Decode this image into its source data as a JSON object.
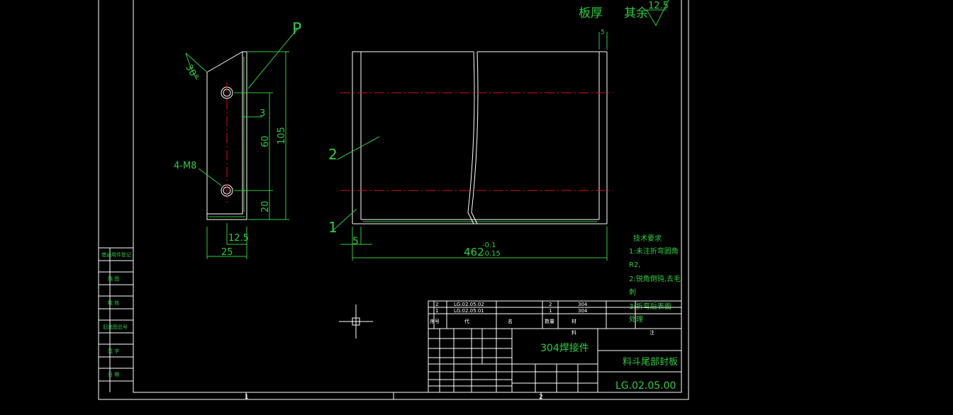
{
  "title_block": {
    "part_name": "料斗尾部封板",
    "drawing_no": "LG.02.05.00",
    "material": "304焊接件",
    "bom": [
      {
        "seq": "2",
        "code": "LG.02.05.02",
        "qty": "2",
        "material": "304"
      },
      {
        "seq": "1",
        "code": "LG.02.05.01",
        "qty": "1",
        "material": "304"
      }
    ],
    "header_seq": "序号",
    "header_code": "代",
    "header_name": "名",
    "header_qty": "数量",
    "header_material": "材",
    "header_misc": "料",
    "header_note": "注"
  },
  "tech_requirements": {
    "title": "技术要求",
    "items": [
      "1:未注折弯圆角",
      "R2,",
      "2:锐角倒钝,去毛",
      "刺",
      "3:折弯后表面",
      "处理"
    ]
  },
  "thickness_note": {
    "label": "板厚",
    "rest": "其余",
    "roughness": "12.5"
  },
  "dims": {
    "angle": "30°",
    "label_p": "P",
    "d3": "3",
    "d60": "60",
    "d105": "105",
    "d20": "20",
    "d12_5": "12.5",
    "d25": "25",
    "holes": "4-M8",
    "d5_top": "5",
    "d5_bottom": "5",
    "d462": "462",
    "tol_upper": "-0.1",
    "tol_lower": "-0.15",
    "leader_1": "1",
    "leader_2": "2"
  },
  "border_zones": [
    "1",
    "2"
  ],
  "left_column": [
    "借通用件登记",
    "描  图",
    "校  核",
    "旧底图总号",
    "签  字",
    "日  期"
  ]
}
